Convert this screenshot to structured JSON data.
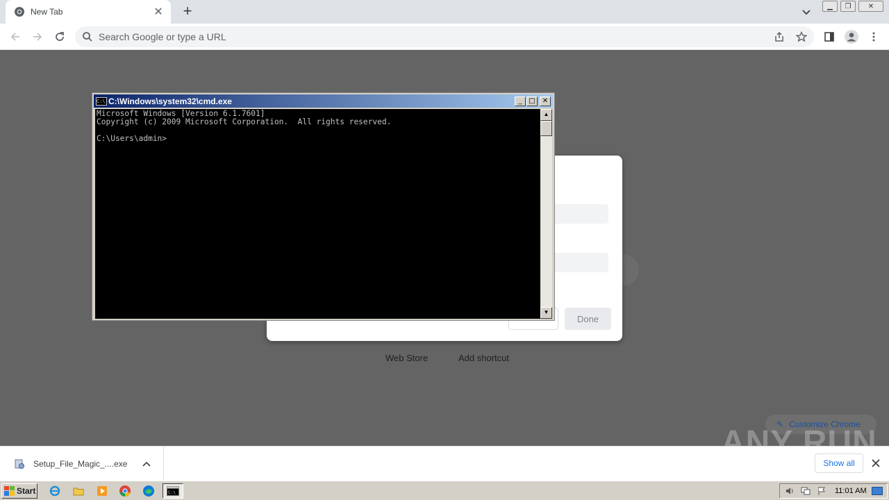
{
  "browser": {
    "tab": {
      "title": "New Tab"
    },
    "omnibox": {
      "placeholder": "Search Google or type a URL"
    }
  },
  "ntp": {
    "dialog": {
      "done_label": "Done"
    },
    "links": [
      "Web Store",
      "Add shortcut"
    ],
    "customize_label": "Customize Chrome",
    "watermark": "ANY RUN"
  },
  "cmd": {
    "title": "C:\\Windows\\system32\\cmd.exe",
    "lines": [
      "Microsoft Windows [Version 6.1.7601]",
      "Copyright (c) 2009 Microsoft Corporation.  All rights reserved.",
      "",
      "C:\\Users\\admin>"
    ]
  },
  "download_bar": {
    "filename": "Setup_File_Magic_....exe",
    "show_all": "Show all"
  },
  "taskbar": {
    "start_label": "Start",
    "clock": "11:01 AM"
  },
  "colors": {
    "cmd_title_start": "#0a246a",
    "cmd_title_end": "#a6caf0",
    "link_blue": "#1a73e8",
    "page_dim": "#646464"
  }
}
